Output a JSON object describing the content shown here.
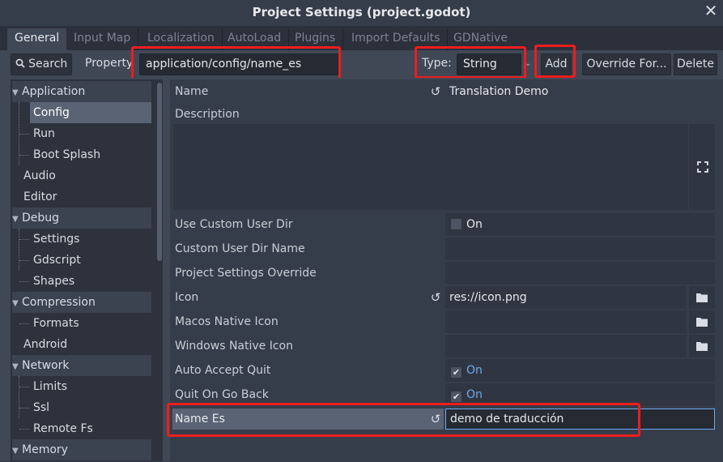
{
  "window": {
    "title": "Project Settings (project.godot)"
  },
  "tabs": [
    "General",
    "Input Map",
    "Localization",
    "AutoLoad",
    "Plugins",
    "Import Defaults",
    "GDNative"
  ],
  "toolbar": {
    "search_label": "Search",
    "property_label": "Property:",
    "property_value": "application/config/name_es",
    "type_label": "Type:",
    "type_value": "String",
    "add_label": "Add",
    "override_label": "Override For...",
    "delete_label": "Delete"
  },
  "tree": {
    "application": "Application",
    "config": "Config",
    "run": "Run",
    "boot_splash": "Boot Splash",
    "audio": "Audio",
    "editor": "Editor",
    "debug": "Debug",
    "settings": "Settings",
    "gdscript": "Gdscript",
    "shapes": "Shapes",
    "compression": "Compression",
    "formats": "Formats",
    "android": "Android",
    "network": "Network",
    "limits": "Limits",
    "ssl": "Ssl",
    "remote_fs": "Remote Fs",
    "memory": "Memory"
  },
  "props": {
    "name_label": "Name",
    "name_value": "Translation Demo",
    "description_label": "Description",
    "use_custom_user_dir_label": "Use Custom User Dir",
    "use_custom_user_dir_value": "On",
    "custom_user_dir_name_label": "Custom User Dir Name",
    "project_settings_override_label": "Project Settings Override",
    "icon_label": "Icon",
    "icon_value": "res://icon.png",
    "macos_native_icon_label": "Macos Native Icon",
    "windows_native_icon_label": "Windows Native Icon",
    "auto_accept_quit_label": "Auto Accept Quit",
    "auto_accept_quit_value": "On",
    "quit_on_go_back_label": "Quit On Go Back",
    "quit_on_go_back_value": "On",
    "name_es_label": "Name Es",
    "name_es_value": "demo de traducción"
  },
  "colors": {
    "accent": "#6ea8ef",
    "highlight": "#ee1d1d"
  },
  "icons": [
    "close-icon",
    "search-icon",
    "chevron-down-icon",
    "revert-icon",
    "folder-icon",
    "expand-icon",
    "check-icon"
  ]
}
